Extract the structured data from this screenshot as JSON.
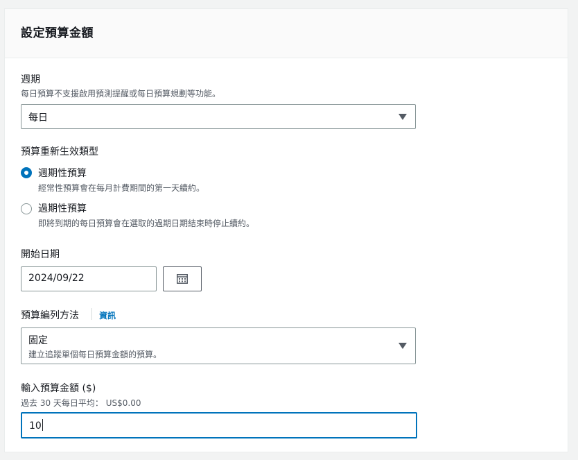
{
  "panel": {
    "title": "設定預算金額"
  },
  "period": {
    "label": "週期",
    "description": "每日預算不支援啟用預測提醒或每日預算規劃等功能。",
    "selected": "每日"
  },
  "renewal": {
    "label": "預算重新生效類型",
    "options": [
      {
        "label": "週期性預算",
        "description": "經常性預算會在每月計費期間的第一天續約。",
        "checked": true
      },
      {
        "label": "過期性預算",
        "description": "即將到期的每日預算會在選取的過期日期結束時停止續約。",
        "checked": false
      }
    ]
  },
  "start_date": {
    "label": "開始日期",
    "value": "2024/09/22"
  },
  "budget_method": {
    "label": "預算編列方法",
    "info_link": "資訊",
    "selected": "固定",
    "selected_description": "建立追蹤單個每日預算金額的預算。"
  },
  "amount": {
    "label": "輸入預算金額 ($)",
    "description": "過去 30 天每日平均： US$0.00",
    "value": "10"
  },
  "colors": {
    "accent": "#0073bb",
    "text": "#16191f",
    "secondary_text": "#545b64",
    "border": "#879596",
    "header_bg": "#fafafa"
  }
}
